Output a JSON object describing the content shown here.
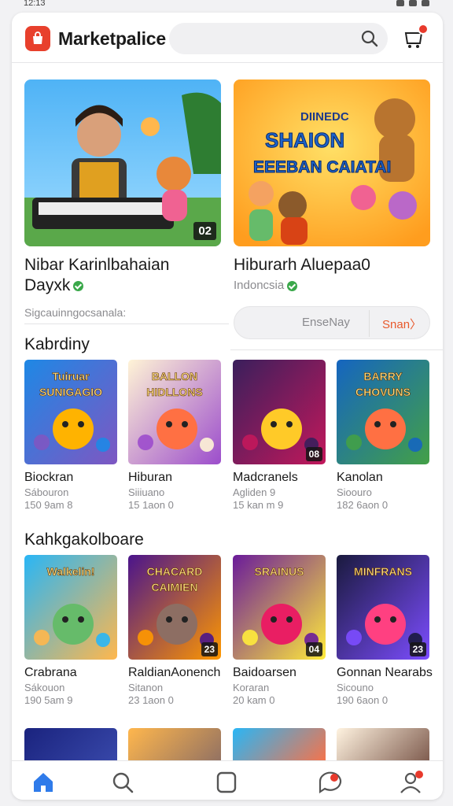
{
  "status_bar": {
    "time": "12:13"
  },
  "header": {
    "app_title": "Marketpalice",
    "search_icon": "search-icon",
    "cart_icon": "cart-icon",
    "accent": "#e8402c"
  },
  "featured": [
    {
      "title_line1": "Nibar Karinlbahaian",
      "title_line2": "Dayxk",
      "tag": "02",
      "verified": true
    },
    {
      "title_line1": "Hiburarh Aluepaa0",
      "location": "Indoncsia",
      "banner_text": [
        "DIINEDC",
        "SHAION",
        "EEEBAN CAIATAI"
      ],
      "verified": true
    }
  ],
  "featured_subtitle": "Sigcauinngocsanala:",
  "actions": {
    "left_label": "EnseNay",
    "right_label": "Snan〉"
  },
  "sections": [
    {
      "title": "Kabrdiny",
      "items": [
        {
          "name": "Biockran",
          "sub1": "Sábouron",
          "sub2": "150 9am 8",
          "art_text": "Tuiruar\nSUNIGAGIO",
          "palette": [
            "#1e88e5",
            "#7e57c2",
            "#ffb300"
          ]
        },
        {
          "name": "Hiburan",
          "sub1": "Siiiuano",
          "sub2": "15 1aon 0",
          "art_text": "BALLON\nHIDLLONS",
          "palette": [
            "#fff4d6",
            "#9c4dcc",
            "#ff7043"
          ]
        },
        {
          "name": "Madcranels",
          "sub1": "Agliden 9",
          "sub2": "15 kan m 9",
          "tag": "08",
          "palette": [
            "#3a1f5c",
            "#c2185b",
            "#ffca28"
          ]
        },
        {
          "name": "Kanolan",
          "sub1": "Sioouro",
          "sub2": "182 6aon 0",
          "art_text": "BARRY\nCHOVUNS",
          "palette": [
            "#1565c0",
            "#43a047",
            "#ff7043"
          ]
        }
      ]
    },
    {
      "title": "Kahkgakolboare",
      "items": [
        {
          "name": "Crabrana",
          "sub1": "Sákouon",
          "sub2": "190 5am 9",
          "art_text": "Walkelin!",
          "palette": [
            "#29b6f6",
            "#ffb74d",
            "#66bb6a"
          ]
        },
        {
          "name": "RaldianAonench",
          "sub1": "Sitanon",
          "sub2": "23 1aon 0",
          "tag": "23",
          "art_text": "CHACARD\nCAIMIEN",
          "palette": [
            "#4a148c",
            "#ff9800",
            "#8d6e63"
          ]
        },
        {
          "name": "Baidoarsen",
          "sub1": "Koraran",
          "sub2": "20 kam 0",
          "tag": "04",
          "art_text": "SRAINUS",
          "palette": [
            "#6a1b9a",
            "#ffeb3b",
            "#e91e63"
          ]
        },
        {
          "name": "Gonnan Nearabs",
          "sub1": "Sicouno",
          "sub2": "190 6aon 0",
          "tag": "23",
          "art_text": "MINFRANS",
          "palette": [
            "#1a1a3e",
            "#7c4dff",
            "#ff4081"
          ]
        }
      ]
    }
  ],
  "bottom_nav": [
    {
      "icon": "home-icon",
      "active": true
    },
    {
      "icon": "search-icon",
      "active": false
    },
    {
      "icon": "square-icon",
      "active": false
    },
    {
      "icon": "chat-icon",
      "active": false
    },
    {
      "icon": "profile-icon",
      "active": false
    }
  ]
}
